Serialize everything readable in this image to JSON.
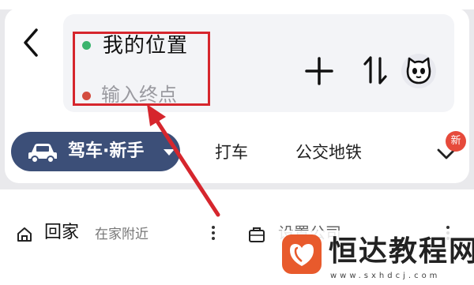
{
  "header": {
    "back_icon": "chevron-left-icon"
  },
  "route": {
    "start_label": "我的位置",
    "start_dot_color": "#3bb46e",
    "destination_placeholder": "输入终点",
    "destination_value": "",
    "end_dot_color": "#d34c3f",
    "add_stop_icon": "plus-icon",
    "swap_icon": "swap-vertical-icon",
    "avatar_icon": "cat-avatar-icon"
  },
  "tabs": {
    "active_label": "驾车·新手",
    "active_icon": "car-icon",
    "active_color": "#3c4f78",
    "taxi": "打车",
    "transit": "公交地铁",
    "more_icon": "chevron-down-icon",
    "new_badge": "新"
  },
  "places": {
    "home_label": "回家",
    "home_sub": "在家附近",
    "company_label": "设置公司",
    "home_icon": "home-icon",
    "company_icon": "briefcase-icon"
  },
  "annotation": {
    "highlight_color": "#d6262d"
  },
  "watermark": {
    "name": "恒达教程网",
    "url": "www.sxhdcj.com"
  }
}
